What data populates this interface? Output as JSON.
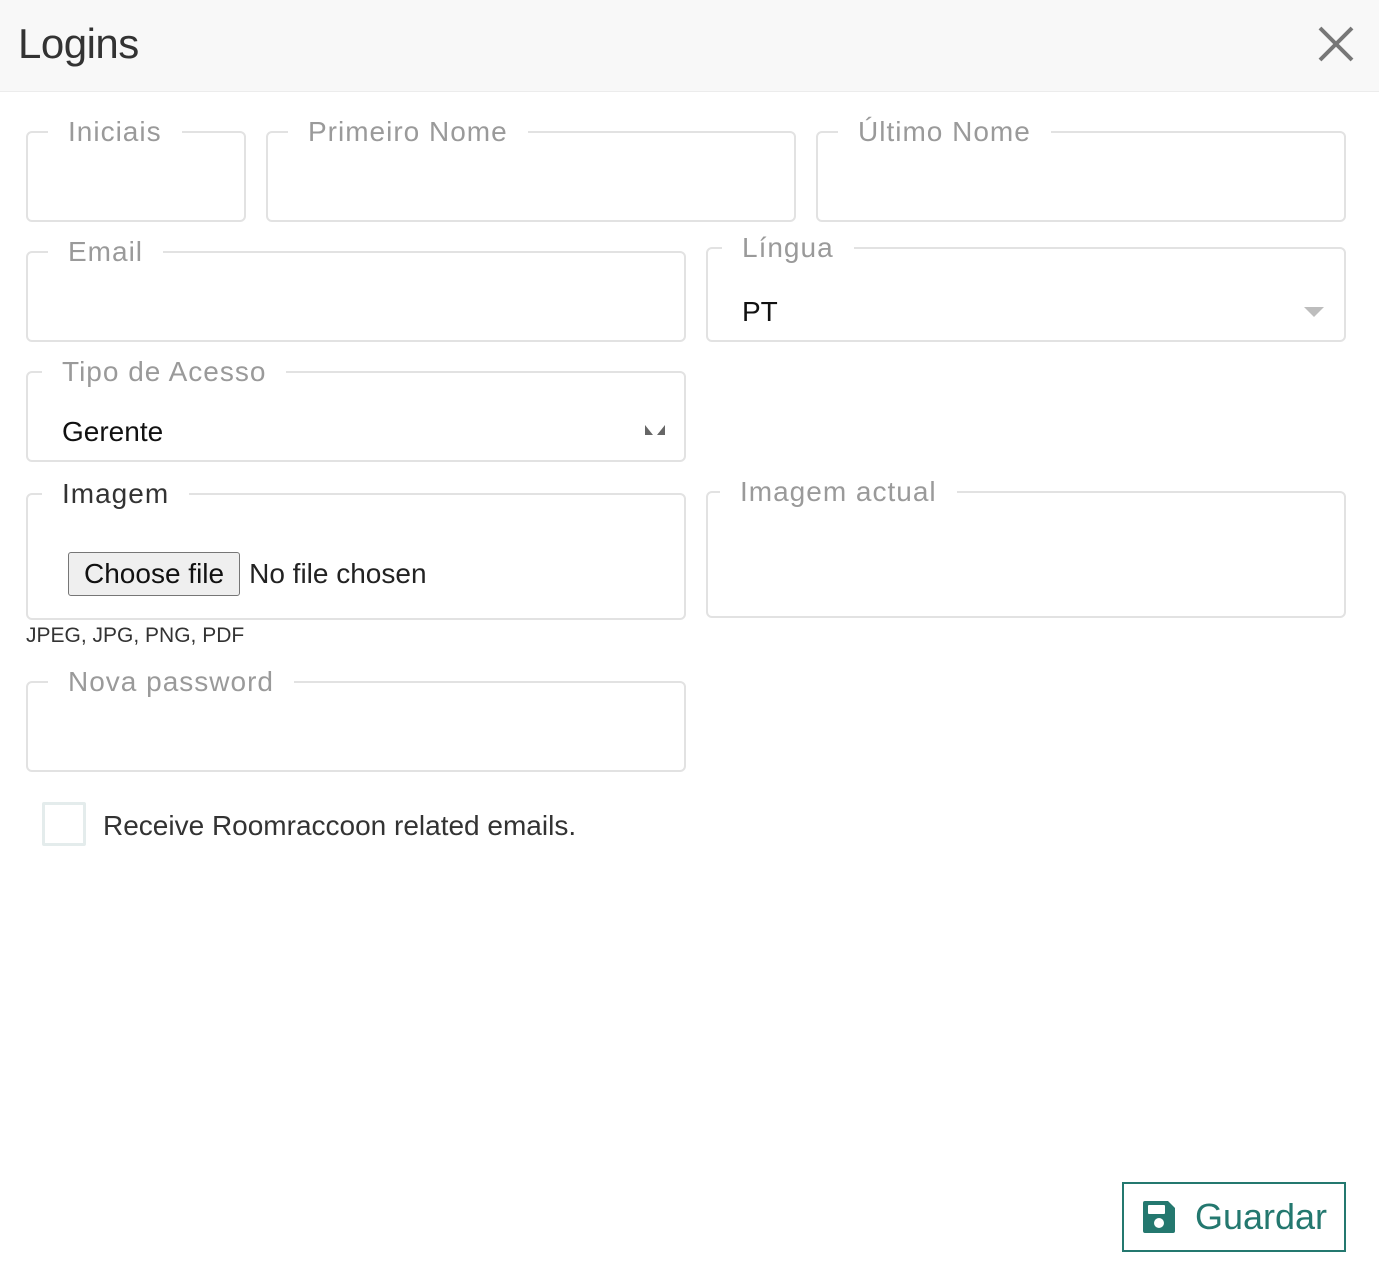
{
  "header": {
    "title": "Logins",
    "close_icon": "close-icon"
  },
  "fields": {
    "iniciais": {
      "label": "Iniciais",
      "value": ""
    },
    "primeiro_nome": {
      "label": "Primeiro Nome",
      "value": ""
    },
    "ultimo_nome": {
      "label": "Último Nome",
      "value": ""
    },
    "email": {
      "label": "Email",
      "value": ""
    },
    "lingua": {
      "label": "Língua",
      "selected": "PT"
    },
    "tipo_acesso": {
      "label": "Tipo de Acesso",
      "selected": "Gerente"
    },
    "imagem": {
      "label": "Imagem",
      "choose_label": "Choose file",
      "no_file_label": "No file chosen",
      "hint": "JPEG, JPG, PNG, PDF"
    },
    "imagem_actual": {
      "label": "Imagem actual"
    },
    "nova_password": {
      "label": "Nova password",
      "value": ""
    }
  },
  "newsletter": {
    "label": "Receive Roomraccoon related emails.",
    "checked": false
  },
  "footer": {
    "save_label": "Guardar",
    "save_icon": "save-icon"
  },
  "colors": {
    "accent": "#24786f",
    "border": "#e2e2e2",
    "label": "#9a9a9a"
  }
}
